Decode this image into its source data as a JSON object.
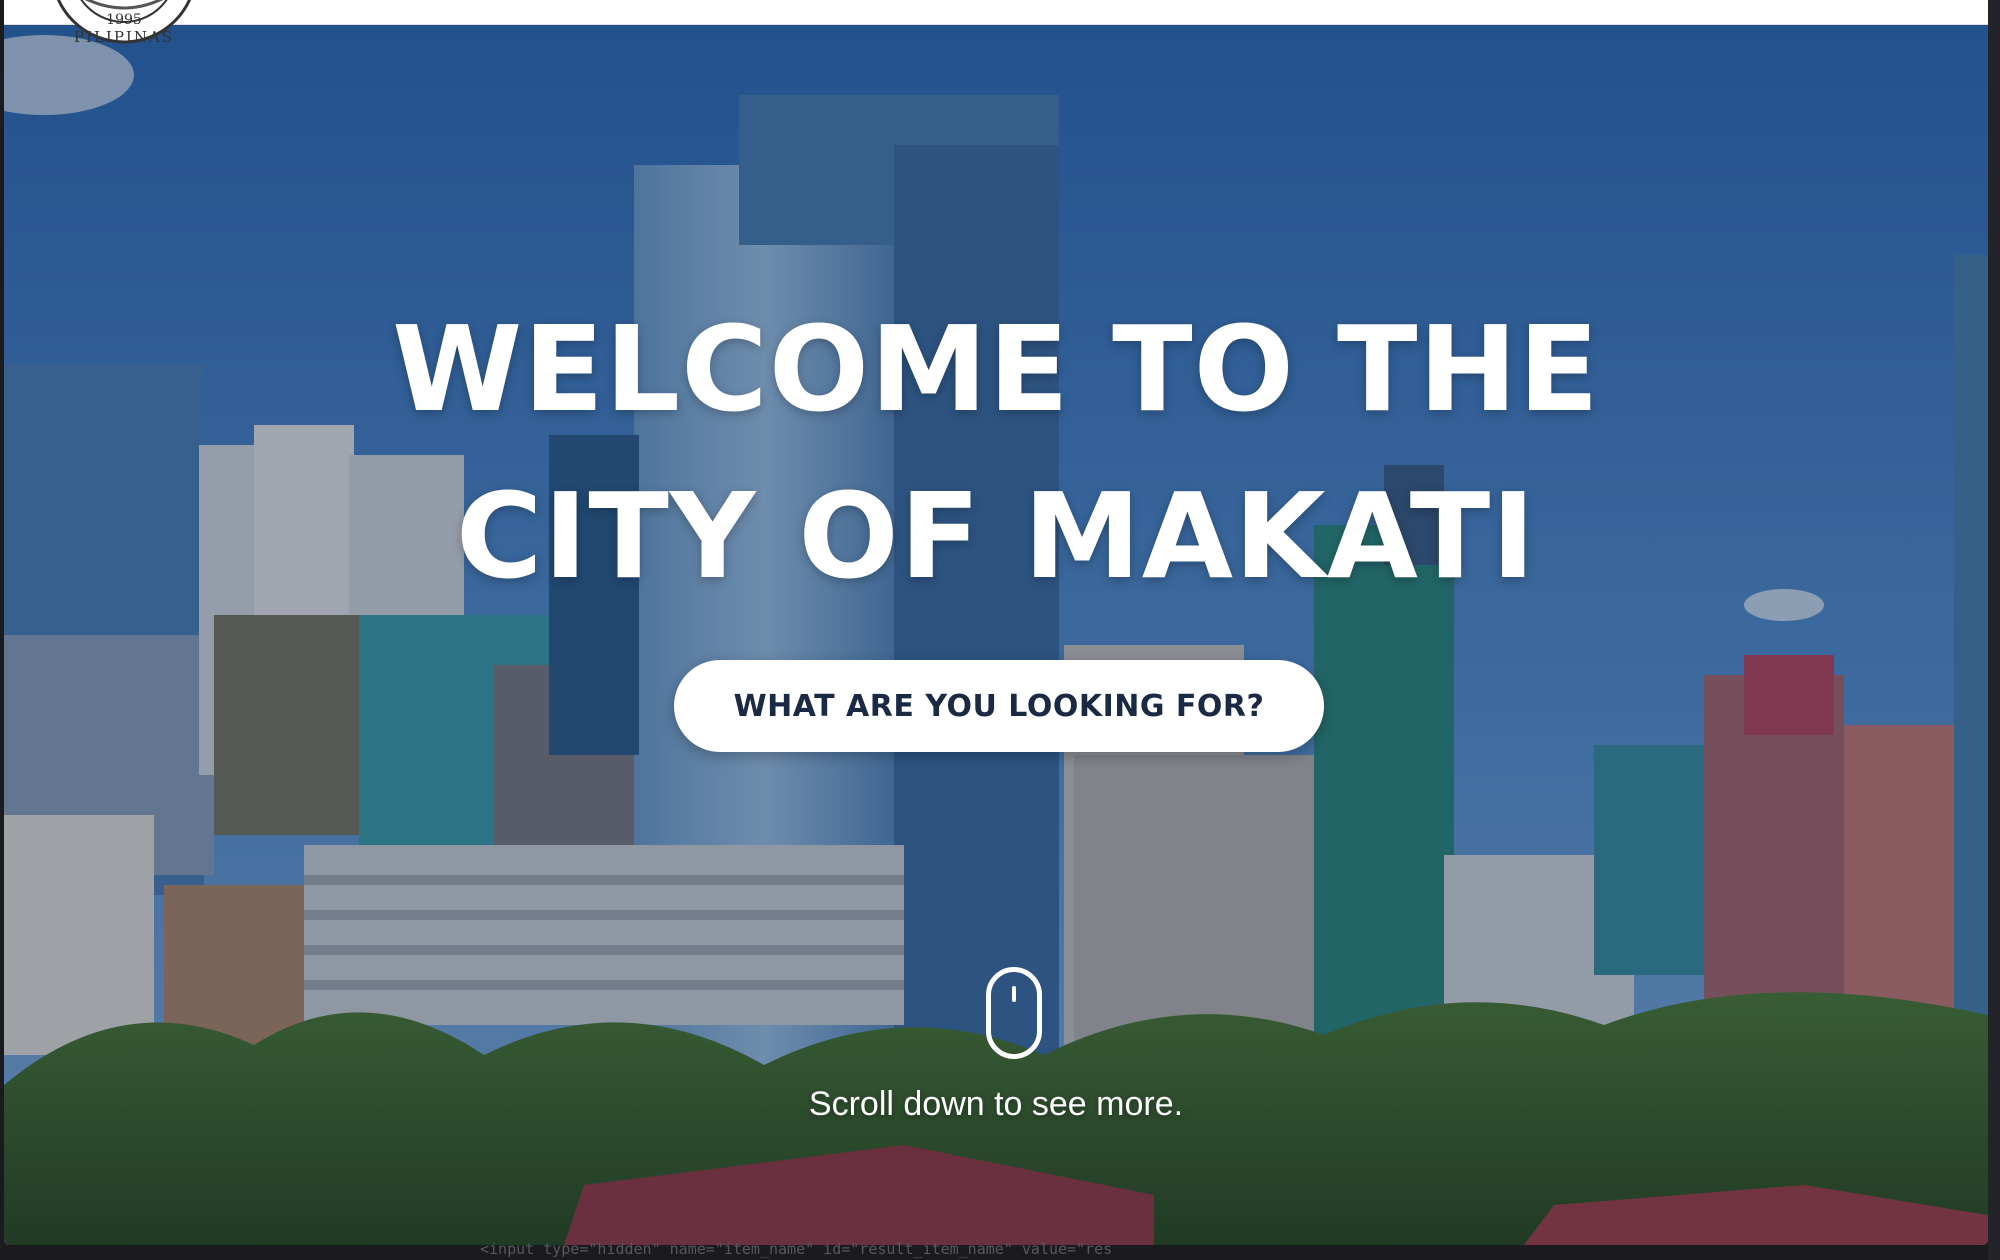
{
  "header": {
    "seal_text": "PILIPINAS",
    "seal_year": "1995"
  },
  "hero": {
    "headline_line1": "WELCOME TO THE",
    "headline_line2": "CITY OF MAKATI",
    "cta_label": "WHAT ARE YOU LOOKING FOR?",
    "scroll_hint": "Scroll down to see more."
  },
  "background_code": {
    "line": "<input type=\"hidden\" name=\"item_name\" id=\"result_item_name\" value=\"res"
  },
  "colors": {
    "overlay": "#08183480",
    "cta_text": "#1a2a44",
    "sky": "#3f7fc6"
  },
  "icons": {
    "scroll": "mouse-scroll-icon",
    "seal": "city-seal-logo"
  }
}
